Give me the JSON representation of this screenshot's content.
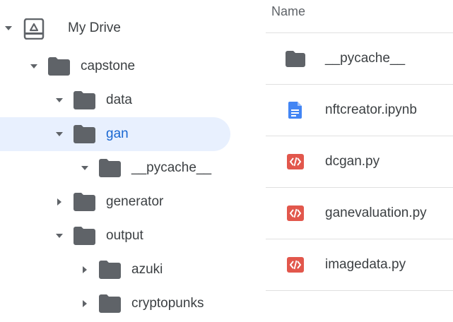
{
  "tree": {
    "root_label": "My Drive",
    "items": [
      {
        "label": "capstone",
        "expanded": true,
        "icon": "folder-icon"
      },
      {
        "label": "data",
        "expanded": true,
        "icon": "folder-icon"
      },
      {
        "label": "gan",
        "expanded": true,
        "selected": true,
        "icon": "folder-icon"
      },
      {
        "label": "__pycache__",
        "expanded": true,
        "icon": "folder-icon"
      },
      {
        "label": "generator",
        "expanded": false,
        "icon": "folder-icon"
      },
      {
        "label": "output",
        "expanded": true,
        "icon": "folder-icon"
      },
      {
        "label": "azuki",
        "expanded": false,
        "icon": "folder-icon"
      },
      {
        "label": "cryptopunks",
        "expanded": false,
        "icon": "folder-icon"
      }
    ]
  },
  "file_list": {
    "column_header": "Name",
    "files": [
      {
        "name": "__pycache__",
        "icon": "folder-icon"
      },
      {
        "name": "nftcreator.ipynb",
        "icon": "google-doc-icon"
      },
      {
        "name": "dcgan.py",
        "icon": "code-file-icon"
      },
      {
        "name": "ganevaluation.py",
        "icon": "code-file-icon"
      },
      {
        "name": "imagedata.py",
        "icon": "code-file-icon"
      }
    ]
  },
  "colors": {
    "folder": "#5f6368",
    "selected_bg": "#e8f0fe",
    "selected_text": "#1967d2",
    "doc_blue": "#4285f4",
    "code_red": "#e2574c"
  }
}
